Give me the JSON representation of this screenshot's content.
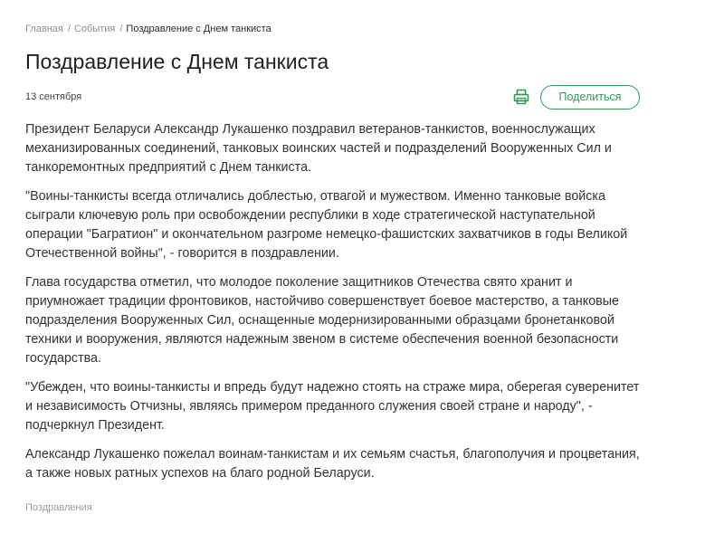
{
  "breadcrumb": {
    "items": [
      "Главная",
      "События"
    ],
    "separator": "/",
    "current": "Поздравление с Днем танкиста"
  },
  "article": {
    "title": "Поздравление с Днем танкиста",
    "date": "13 сентября",
    "paragraphs": [
      "Президент Беларуси Александр Лукашенко поздравил ветеранов-танкистов, военнослужащих механизированных соединений, танковых воинских частей и подразделений Вооруженных Сил и танкоремонтных предприятий с Днем танкиста.",
      "\"Воины-танкисты всегда отличались доблестью, отвагой и мужеством. Именно танковые войска сыграли ключевую роль при освобождении республики в ходе стратегической наступательной операции \"Багратион\" и окончательном разгроме немецко-фашистских захватчиков в годы Великой Отечественной войны\", - говорится в поздравлении.",
      "Глава государства отметил, что молодое поколение защитников Отечества свято хранит и приумножает традиции фронтовиков, настойчиво совершенствует боевое мастерство, а танковые подразделения Вооруженных Сил, оснащенные модернизированными образцами бронетанковой техники и вооружения, являются надежным звеном в системе обеспечения военной безопасности государства.",
      "\"Убежден, что воины-танкисты и впредь будут надежно стоять на страже мира, оберегая суверенитет и независимость Отчизны, являясь примером преданного служения своей стране и народу\", - подчеркнул Президент.",
      "Александр Лукашенко пожелал воинам-танкистам и их семьям счастья, благополучия и процветания, а также новых ратных успехов на благо родной Беларуси."
    ],
    "tag": "Поздравления"
  },
  "actions": {
    "print_icon": "printer-icon",
    "share_label": "Поделиться"
  },
  "colors": {
    "accent": "#2e9a57",
    "text": "#333333",
    "muted": "#8a8f96"
  }
}
